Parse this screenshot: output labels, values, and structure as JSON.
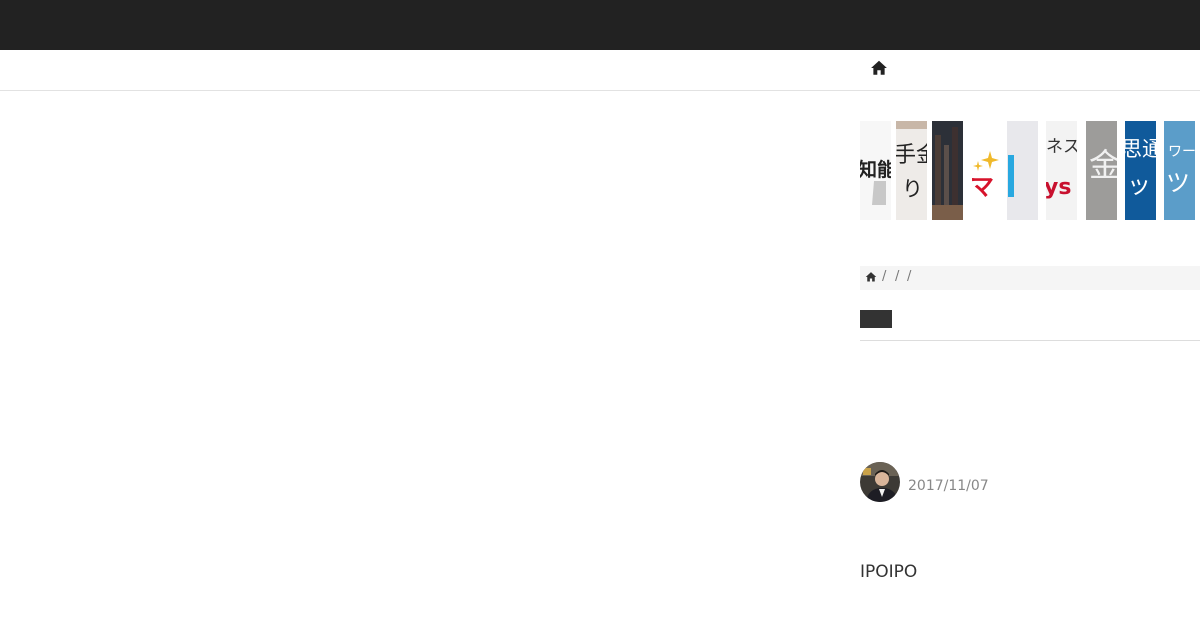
{
  "nav": {
    "home_icon": "home-icon"
  },
  "slider": {
    "thumbnails": [
      {
        "id": "thumb-1",
        "text": "知能"
      },
      {
        "id": "thumb-2",
        "text": "手金"
      },
      {
        "id": "thumb-2b",
        "text": "り"
      },
      {
        "id": "thumb-4",
        "text": "マ"
      },
      {
        "id": "thumb-6",
        "text": "ネス"
      },
      {
        "id": "thumb-6b",
        "text": "ys"
      },
      {
        "id": "thumb-7",
        "text": "金"
      },
      {
        "id": "thumb-8",
        "text": "思通"
      },
      {
        "id": "thumb-8b",
        "text": "ッ"
      },
      {
        "id": "thumb-9",
        "text": "ワー"
      },
      {
        "id": "thumb-9b",
        "text": "ツ"
      }
    ]
  },
  "breadcrumb": {
    "home_icon": "home-icon",
    "separators": [
      "/",
      "/",
      "/"
    ]
  },
  "post": {
    "date": "2017/11/07",
    "body_text": "IPOIPO"
  },
  "colors": {
    "topbar": "#222222",
    "badge": "#333333"
  }
}
